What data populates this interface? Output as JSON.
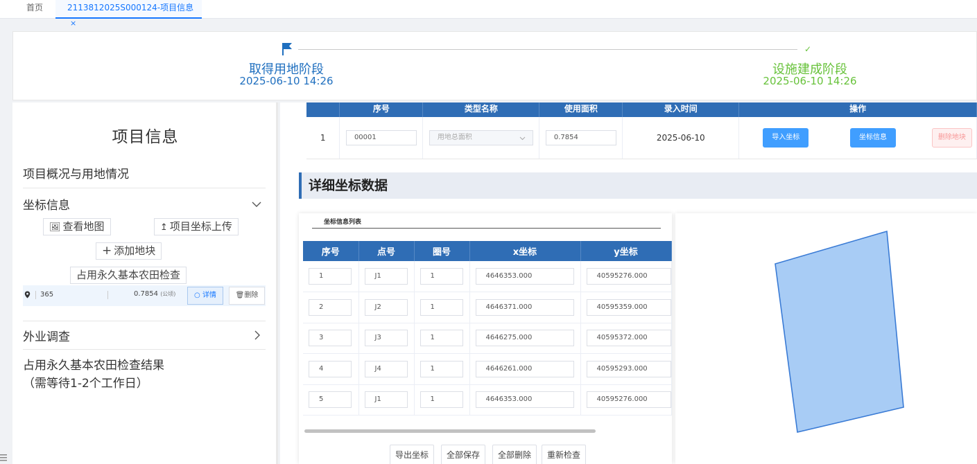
{
  "tabs": {
    "home": "首页",
    "active": "2113812025S000124-项目信息",
    "close": "×"
  },
  "stages": {
    "stage1": {
      "label": "取得用地阶段",
      "date": "2025-06-10 14:26"
    },
    "stage2": {
      "label": "设施建成阶段",
      "date": "2025-06-10 14:26"
    }
  },
  "left": {
    "title": "项目信息",
    "overview": "项目概况与用地情况",
    "coord_info": "坐标信息",
    "view_map": "查看地图",
    "upload": "项目坐标上传",
    "add_plot": "添加地块",
    "check": "占用永久基本农田检查",
    "plot": {
      "number": "365",
      "area": "0.7854",
      "unit": "(公顷)",
      "detail": "详情",
      "delete": "删除"
    },
    "field_survey": "外业调查",
    "result_line1": "占用永久基本农田检查结果",
    "result_line2": "（需等待1-2个工作日）"
  },
  "land_table": {
    "headers": [
      "序号",
      "类型名称",
      "使用面积",
      "录入时间",
      "操作"
    ],
    "row": {
      "index": "1",
      "serial": "00001",
      "type": "用地总面积",
      "area": "0.7854",
      "date": "2025-06-10",
      "import": "导入坐标",
      "coord_info": "坐标信息",
      "delete": "删除地块"
    }
  },
  "detail_section": "详细坐标数据",
  "coord_card": {
    "title": "坐标信息列表",
    "headers": [
      "序号",
      "点号",
      "圈号",
      "x坐标",
      "y坐标"
    ],
    "rows": [
      {
        "idx": "1",
        "point": "J1",
        "ring": "1",
        "x": "4646353.000",
        "y": "40595276.000"
      },
      {
        "idx": "2",
        "point": "J2",
        "ring": "1",
        "x": "4646371.000",
        "y": "40595359.000"
      },
      {
        "idx": "3",
        "point": "J3",
        "ring": "1",
        "x": "4646275.000",
        "y": "40595372.000"
      },
      {
        "idx": "4",
        "point": "J4",
        "ring": "1",
        "x": "4646261.000",
        "y": "40595293.000"
      },
      {
        "idx": "5",
        "point": "J1",
        "ring": "1",
        "x": "4646353.000",
        "y": "40595276.000"
      }
    ],
    "actions": {
      "export": "导出坐标",
      "save_all": "全部保存",
      "delete_all": "全部删除",
      "recheck": "重新检查"
    }
  },
  "colors": {
    "primary": "#2f6db5",
    "accent": "#1677ff",
    "success": "#67c23a",
    "polygon_fill": "#a8ccf5",
    "polygon_stroke": "#3a7bd5"
  }
}
